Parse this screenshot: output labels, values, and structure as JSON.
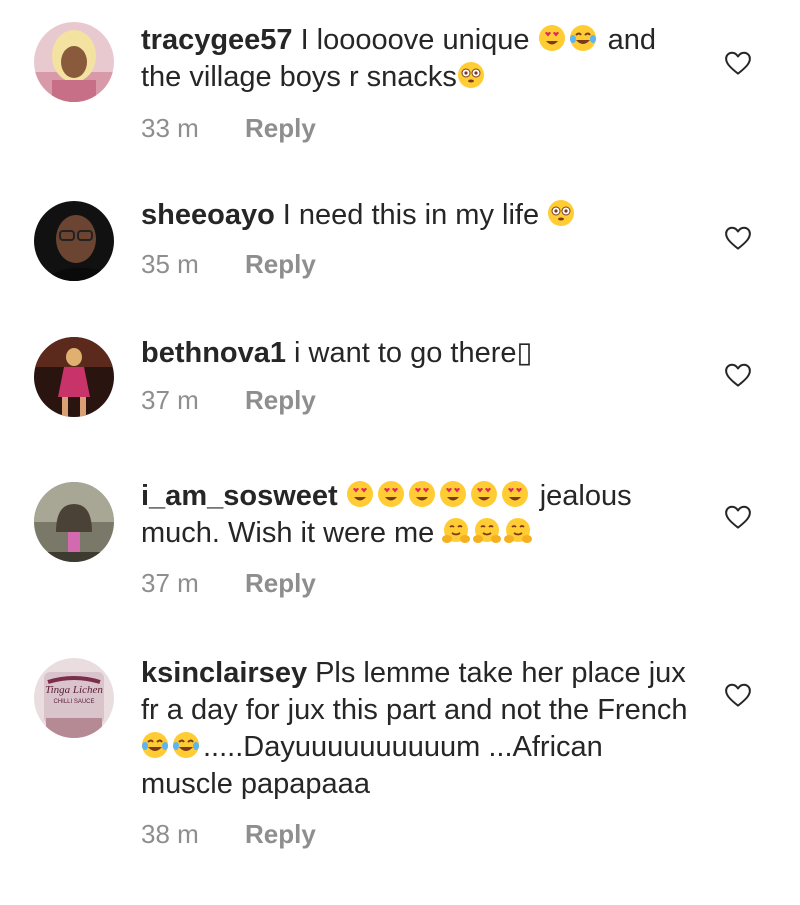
{
  "comments": [
    {
      "username": "tracygee57",
      "text_parts": [
        "I looooove unique ",
        "{heart-eyes}",
        "{tears-of-joy}",
        " and the village boys r snacks",
        "{flushed}"
      ],
      "time": "33 m",
      "reply_label": "Reply",
      "avatar_icon": "avatar-photo"
    },
    {
      "username": "sheeoayo",
      "text_parts": [
        "I need this in my life ",
        "{flushed}"
      ],
      "time": "35 m",
      "reply_label": "Reply",
      "avatar_icon": "avatar-photo"
    },
    {
      "username": "bethnova1",
      "text_parts": [
        "i want to go there",
        "▯"
      ],
      "time": "37 m",
      "reply_label": "Reply",
      "avatar_icon": "avatar-photo"
    },
    {
      "username": "i_am_sosweet",
      "text_parts": [
        "{heart-eyes}",
        "{heart-eyes}",
        "{heart-eyes}",
        "{heart-eyes}",
        "{heart-eyes}",
        "{heart-eyes}",
        " jealous much. Wish it were me ",
        "{hugging}",
        "{hugging}",
        "{hugging}"
      ],
      "time": "37 m",
      "reply_label": "Reply",
      "avatar_icon": "avatar-photo"
    },
    {
      "username": "ksinclairsey",
      "text_parts": [
        "Pls lemme take her place jux fr a day for jux this part and not the French ",
        "{tears-of-joy}",
        "{tears-of-joy}",
        ".....Dayuuuuuuuuuum ...African muscle papapaaa"
      ],
      "time": "38 m",
      "reply_label": "Reply",
      "avatar_icon": "avatar-photo",
      "avatar_text": "Tinga Lichen CHILLI SAUCE"
    }
  ],
  "icons": {
    "like": "heart-outline-icon"
  },
  "colors": {
    "text": "#262626",
    "meta": "#8e8e8e",
    "heart_stroke": "#262626",
    "emoji_face": "#ffcc33",
    "emoji_heart": "#e0245e"
  }
}
